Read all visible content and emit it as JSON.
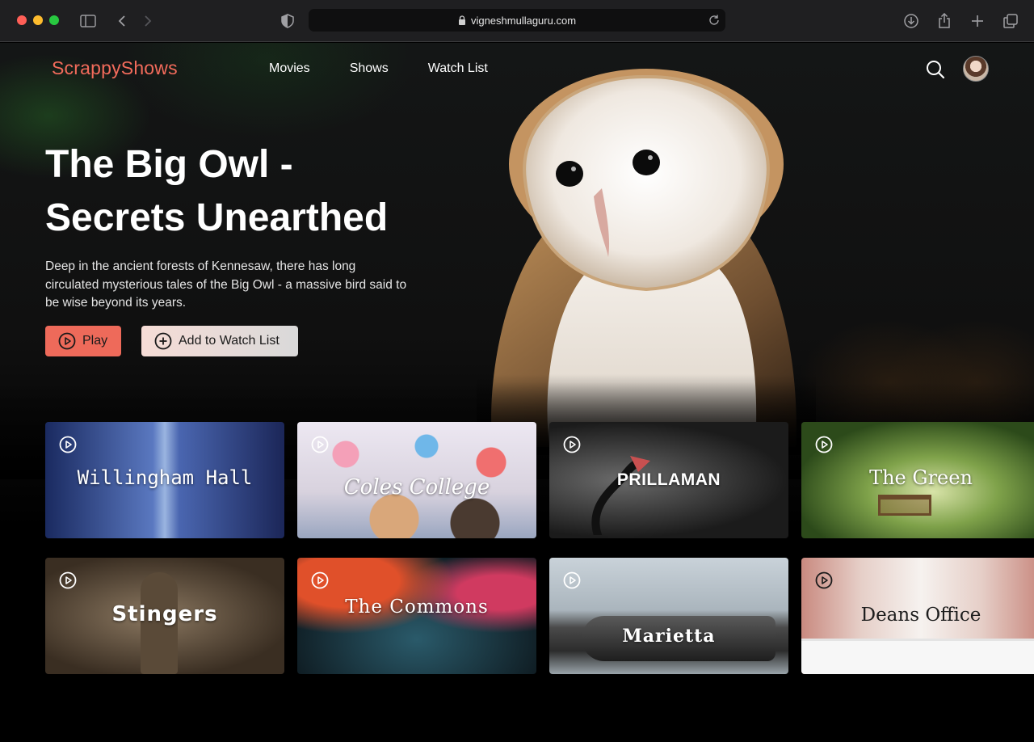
{
  "browser": {
    "url": "vigneshmullaguru.com"
  },
  "site": {
    "logo": "ScrappyShows",
    "nav": [
      "Movies",
      "Shows",
      "Watch List"
    ]
  },
  "hero": {
    "title_line1": "The Big Owl -",
    "title_line2": "Secrets Unearthed",
    "description": "Deep in the ancient forests of Kennesaw, there has long circulated mysterious tales of the Big Owl - a massive bird said to be wise beyond its years.",
    "play_label": "Play",
    "watchlist_label": "Add to Watch List"
  },
  "shows": [
    "Willingham Hall",
    "Coles College",
    "PRILLAMAN",
    "The Green",
    "Stingers",
    "The Commons",
    "Marietta",
    "Deans Office"
  ],
  "colors": {
    "brand": "#f26b5b",
    "play_button": "#ee6a5a"
  }
}
